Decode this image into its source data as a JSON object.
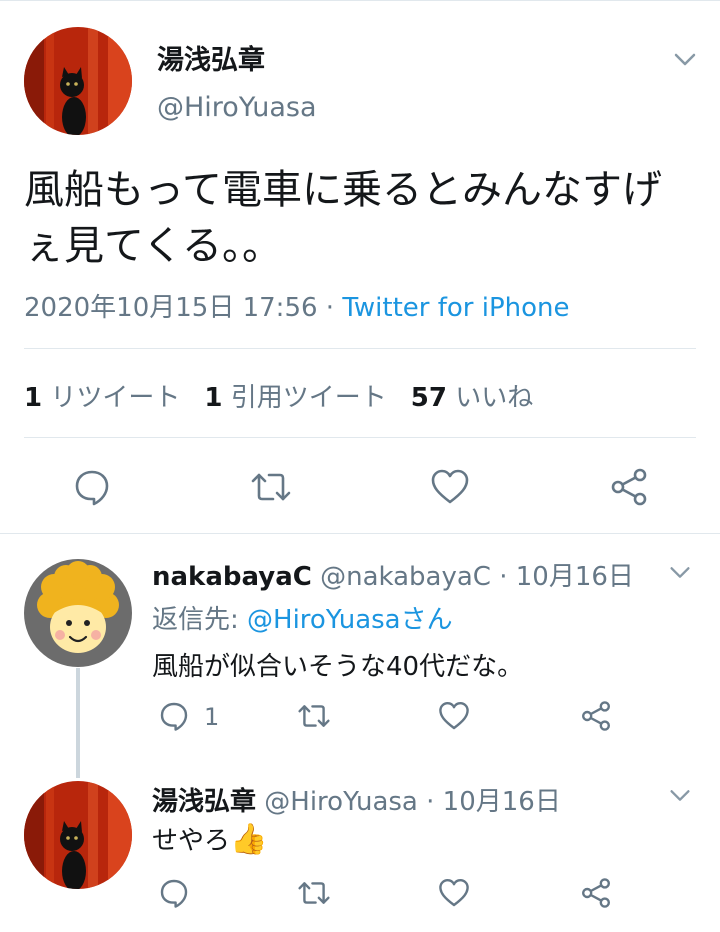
{
  "main_tweet": {
    "display_name": "湯浅弘章",
    "handle": "@HiroYuasa",
    "text": "風船もって電車に乗るとみんなすげぇ見てくる。。",
    "timestamp": "2020年10月15日 17:56",
    "separator": " · ",
    "source": "Twitter for iPhone",
    "stats": {
      "retweets_count": "1",
      "retweets_label": "リツイート",
      "quotes_count": "1",
      "quotes_label": "引用ツイート",
      "likes_count": "57",
      "likes_label": "いいね"
    }
  },
  "replies": [
    {
      "display_name": "nakabayaC",
      "handle": "@nakabayaC",
      "date": " · 10月16日",
      "reply_to_label": "返信先: ",
      "reply_to_handle": "@HiroYuasaさん",
      "text": "風船が似合いそうな40代だな。",
      "reply_count": "1"
    },
    {
      "display_name": "湯浅弘章",
      "handle": "@HiroYuasa",
      "date": " · 10月16日",
      "text": "せやろ",
      "emoji": "👍"
    }
  ],
  "colors": {
    "text": "#14171a",
    "secondary": "#657786",
    "link": "#1b95e0",
    "divider": "#e1e8ed",
    "thread_line": "#ccd6dd"
  },
  "icons": [
    "chevron-down-icon",
    "reply-icon",
    "retweet-icon",
    "like-icon",
    "share-icon"
  ]
}
